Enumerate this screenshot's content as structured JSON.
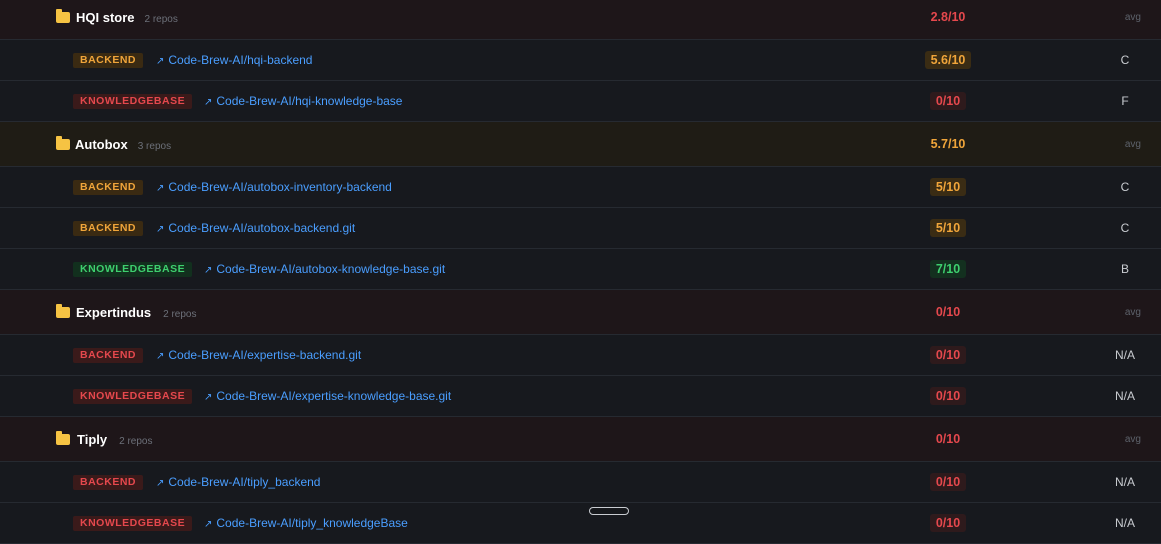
{
  "groups": [
    {
      "name": "HQI store",
      "count": "2 repos",
      "score": "2.8/10",
      "avg": "avg",
      "repos": [
        {
          "type": "BACKEND",
          "link": "Code-Brew-AI/hqi-backend",
          "score": "5.6/10",
          "grade": "C"
        },
        {
          "type": "KNOWLEDGEBASE",
          "link": "Code-Brew-AI/hqi-knowledge-base",
          "score": "0/10",
          "grade": "F"
        }
      ]
    },
    {
      "name": "Autobox",
      "count": "3 repos",
      "score": "5.7/10",
      "avg": "avg",
      "repos": [
        {
          "type": "BACKEND",
          "link": "Code-Brew-AI/autobox-inventory-backend",
          "score": "5/10",
          "grade": "C"
        },
        {
          "type": "BACKEND",
          "link": "Code-Brew-AI/autobox-backend.git",
          "score": "5/10",
          "grade": "C"
        },
        {
          "type": "KNOWLEDGEBASE",
          "link": "Code-Brew-AI/autobox-knowledge-base.git",
          "score": "7/10",
          "grade": "B"
        }
      ]
    },
    {
      "name": "Expertindus",
      "count": "2 repos",
      "score": "0/10",
      "avg": "avg",
      "repos": [
        {
          "type": "BACKEND",
          "link": "Code-Brew-AI/expertise-backend.git",
          "score": "0/10",
          "grade": "N/A"
        },
        {
          "type": "KNOWLEDGEBASE",
          "link": "Code-Brew-AI/expertise-knowledge-base.git",
          "score": "0/10",
          "grade": "N/A"
        }
      ]
    },
    {
      "name": "Tiply",
      "count": "2 repos",
      "score": "0/10",
      "avg": "avg",
      "repos": [
        {
          "type": "BACKEND",
          "link": "Code-Brew-AI/tiply_backend",
          "score": "0/10",
          "grade": "N/A"
        },
        {
          "type": "KNOWLEDGEBASE",
          "link": "Code-Brew-AI/tiply_knowledgeBase",
          "score": "0/10",
          "grade": "N/A"
        }
      ]
    }
  ],
  "icons": {
    "folder": "folder-icon",
    "external_link": "external-link-icon",
    "arrow": "↗"
  },
  "colors": {
    "score_low": "#e5484d",
    "score_mid": "#f0a53a",
    "score_high": "#3ecf6e",
    "link": "#4a9eff",
    "folder": "#f6c343"
  }
}
